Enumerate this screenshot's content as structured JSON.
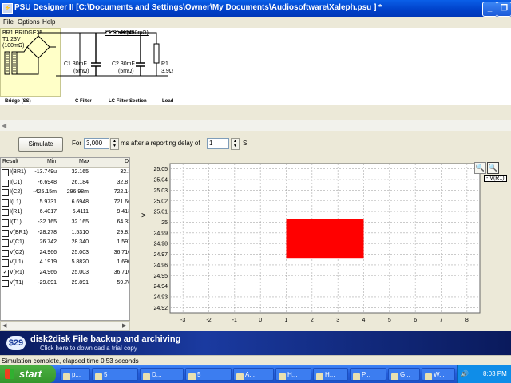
{
  "window": {
    "title": "PSU Designer II  [C:\\Documents and Settings\\Owner\\My Documents\\Audiosoftware\\Xaleph.psu ] *",
    "minimize_label": "_",
    "restore_label": "❐"
  },
  "menu": {
    "items": [
      "File",
      "Options",
      "Help"
    ]
  },
  "schematic": {
    "bridge": {
      "line1": "BR1 BRIDGE25",
      "line2": "T1 23V",
      "line3": "(100mΩ)"
    },
    "inductor_label": "L1 3mH (400mΩ)",
    "c1": {
      "line1": "C1 30mF",
      "line2": "(5mΩ)"
    },
    "c2": {
      "line1": "C2 30mF",
      "line2": "(5mΩ)"
    },
    "r1": {
      "line1": "R1",
      "line2": "3.9Ω"
    },
    "captions": [
      "Bridge (SS)",
      "C Filter",
      "LC Filter Section",
      "Load"
    ]
  },
  "simulation": {
    "simulate_label": "Simulate",
    "for_label": "For",
    "duration_value": "3,000",
    "ms_label": "ms  after a reporting delay of",
    "delay_value": "1",
    "s_label": "S"
  },
  "results": {
    "headers": [
      "Result",
      "Min",
      "Max",
      "D"
    ],
    "rows": [
      {
        "name": "I(BR1)",
        "min": "-13.749u",
        "max": "32.165",
        "d": "32.1",
        "checked": false
      },
      {
        "name": "I(C1)",
        "min": "-6.6948",
        "max": "26.184",
        "d": "32.87",
        "checked": false
      },
      {
        "name": "I(C2)",
        "min": "-425.15m",
        "max": "296.98m",
        "d": "722.14",
        "checked": false
      },
      {
        "name": "I(L1)",
        "min": "5.9731",
        "max": "6.6948",
        "d": "721.66",
        "checked": false
      },
      {
        "name": "I(R1)",
        "min": "6.4017",
        "max": "6.4111",
        "d": "9.413",
        "checked": false
      },
      {
        "name": "I(T1)",
        "min": "-32.165",
        "max": "32.165",
        "d": "64.33",
        "checked": false
      },
      {
        "name": "V(BR1)",
        "min": "-28.278",
        "max": "1.5310",
        "d": "29.81",
        "checked": false
      },
      {
        "name": "V(C1)",
        "min": "26.742",
        "max": "28.340",
        "d": "1.597",
        "checked": false
      },
      {
        "name": "V(C2)",
        "min": "24.966",
        "max": "25.003",
        "d": "36.710",
        "checked": false
      },
      {
        "name": "V(L1)",
        "min": "4.1919",
        "max": "5.8820",
        "d": "1.690",
        "checked": false
      },
      {
        "name": "V(R1)",
        "min": "24.966",
        "max": "25.003",
        "d": "36.710",
        "checked": true
      },
      {
        "name": "V(T1)",
        "min": "-29.891",
        "max": "29.891",
        "d": "59.78",
        "checked": false
      }
    ]
  },
  "plot": {
    "legend_label": "- V(R1)",
    "cursor_glyph": ">"
  },
  "chart_data": {
    "type": "area",
    "x_ticks": [
      "-3",
      "-2",
      "-1",
      "0",
      "1",
      "2",
      "3",
      "4",
      "5",
      "6",
      "7",
      "8"
    ],
    "y_ticks": [
      "25.05",
      "25.04",
      "25.03",
      "25.02",
      "25.01",
      "25",
      "24.99",
      "24.98",
      "24.97",
      "24.96",
      "24.95",
      "24.94",
      "24.93",
      "24.92"
    ],
    "xlim": [
      -3.5,
      8.5
    ],
    "ylim": [
      24.915,
      25.055
    ],
    "grid": true,
    "series": [
      {
        "color": "#ff0000",
        "rect": {
          "x0": 1,
          "x1": 4,
          "y0": 24.9665,
          "y1": 25.003
        }
      }
    ]
  },
  "ad": {
    "price": "$29",
    "headline": "disk2disk File backup and archiving",
    "subline": "Click here to download a trial copy"
  },
  "status": {
    "text": "Simulation complete, elapsed time 0.53 seconds"
  },
  "taskbar": {
    "start_label": "start",
    "tasks": [
      "p...",
      "5",
      "D...",
      "5",
      "A...",
      "H...",
      "H...",
      "P...",
      "G...",
      "W..."
    ],
    "clock": "8:03 PM"
  },
  "colors": {
    "accent": "#0a5fe8",
    "trace": "#ff0000",
    "taskbar": "#245edb"
  }
}
